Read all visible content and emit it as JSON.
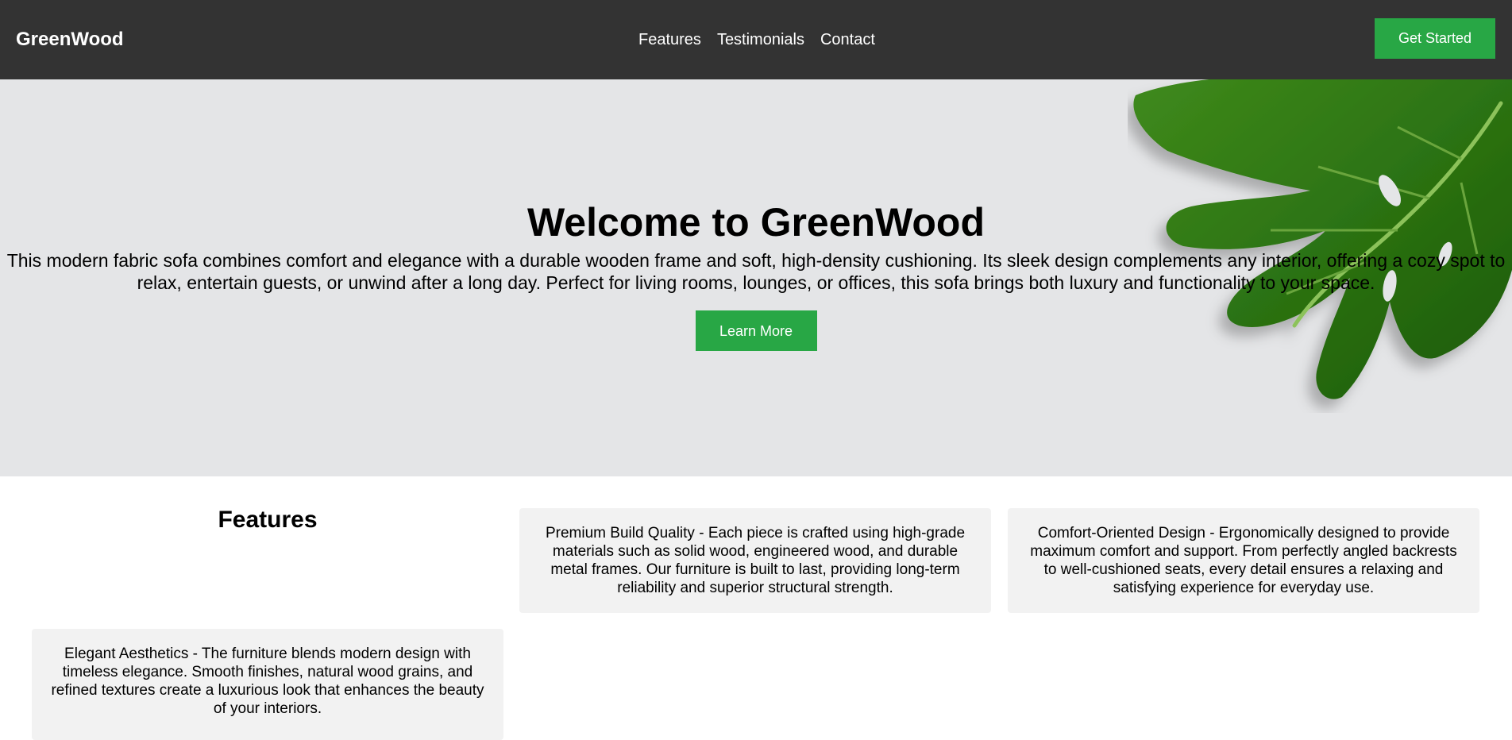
{
  "navbar": {
    "logo": "GreenWood",
    "links": [
      "Features",
      "Testimonials",
      "Contact"
    ],
    "cta_label": "Get Started"
  },
  "hero": {
    "title": "Welcome to GreenWood",
    "text": "This modern fabric sofa combines comfort and elegance with a durable wooden frame and soft, high-density cushioning. Its sleek design complements any interior, offering a cozy spot to relax, entertain guests, or unwind after a long day. Perfect for living rooms, lounges, or offices, this sofa brings both luxury and functionality to your space.",
    "button_label": "Learn More",
    "image": "monstera-leaf-image"
  },
  "features": {
    "title": "Features",
    "cards": [
      "Premium Build Quality - Each piece is crafted using high-grade materials such as solid wood, engineered wood, and durable metal frames. Our furniture is built to last, providing long-term reliability and superior structural strength.",
      "Comfort-Oriented Design - Ergonomically designed to provide maximum comfort and support. From perfectly angled backrests to well-cushioned seats, every detail ensures a relaxing and satisfying experience for everyday use.",
      "Elegant Aesthetics - The furniture blends modern design with timeless elegance. Smooth finishes, natural wood grains, and refined textures create a luxurious look that enhances the beauty of your interiors."
    ]
  },
  "colors": {
    "navbar_bg": "#333333",
    "accent": "#28a745",
    "hero_bg": "#e4e5e7",
    "card_bg": "#f2f2f2"
  }
}
